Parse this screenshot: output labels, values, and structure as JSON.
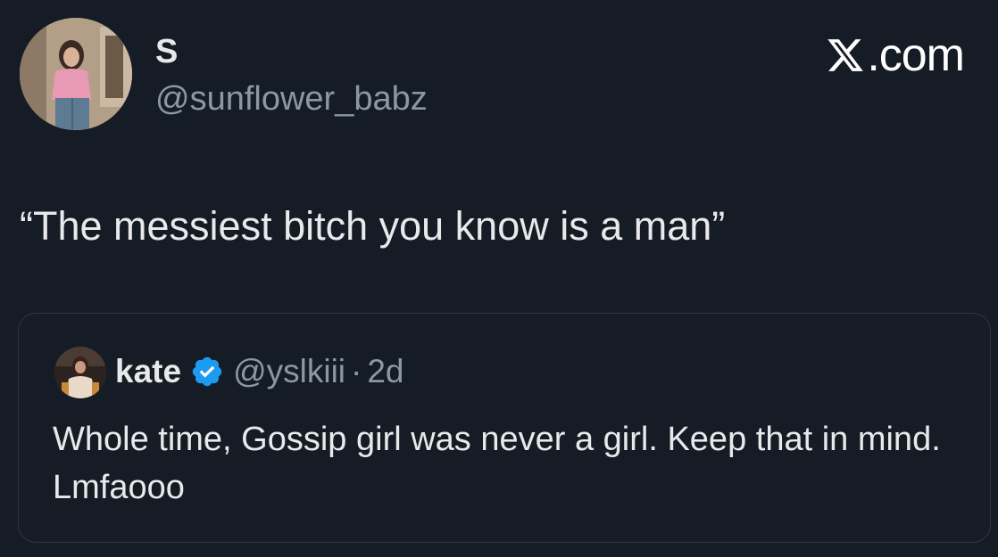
{
  "author": {
    "display_name": "S",
    "handle": "@sunflower_babz"
  },
  "brand": {
    "label": ".com",
    "icon": "x-logo-icon"
  },
  "tweet": {
    "text": "“The messiest bitch you know is a man”"
  },
  "quoted_tweet": {
    "display_name": "kate",
    "verified_icon": "verified-badge-icon",
    "handle": "@yslkiii",
    "separator": "·",
    "time": "2d",
    "text": "Whole time, Gossip girl was never a girl. Keep that in mind. Lmfaooo"
  },
  "colors": {
    "background": "#161c25",
    "text_primary": "#e7e9ea",
    "text_secondary": "#8b98a5",
    "verified": "#1d9bf0",
    "border": "#2f3640"
  }
}
